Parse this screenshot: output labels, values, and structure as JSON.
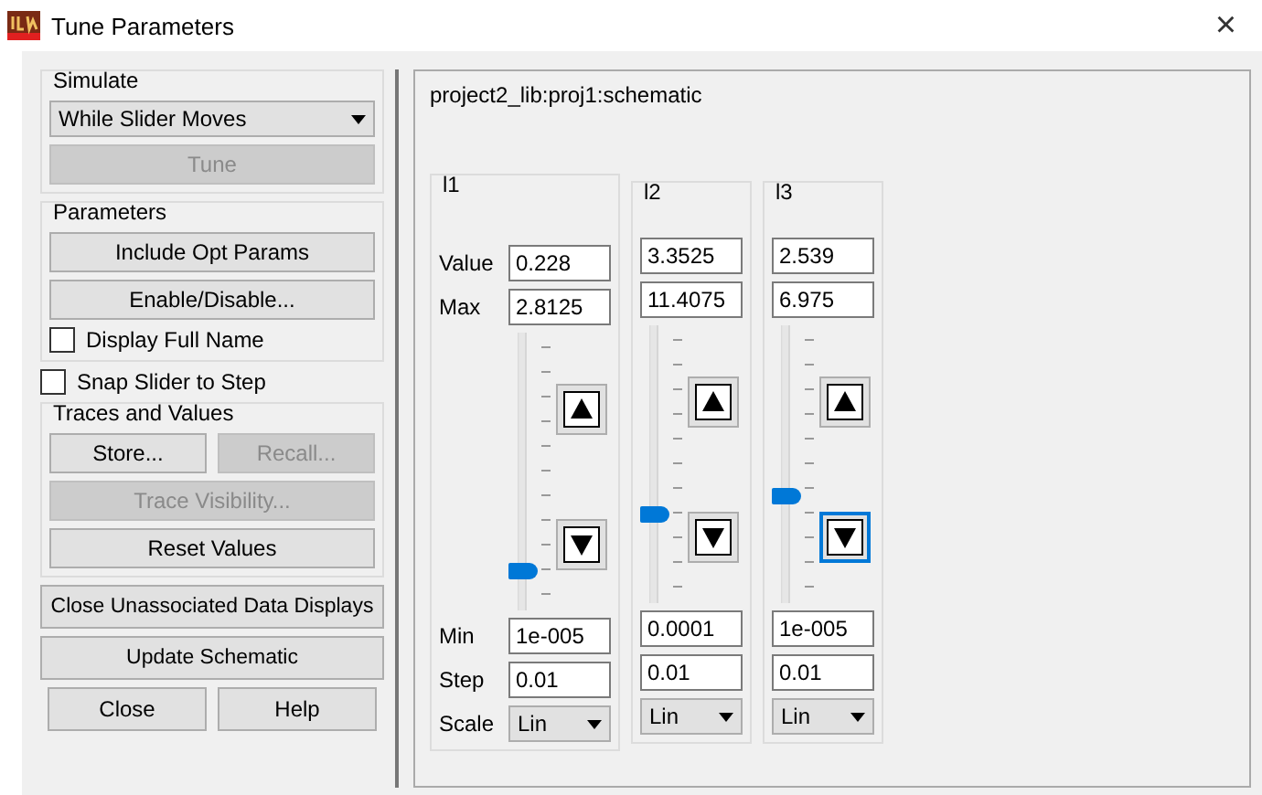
{
  "window": {
    "title": "Tune Parameters",
    "close": "×"
  },
  "simulate": {
    "legend": "Simulate",
    "mode": "While Slider Moves",
    "tune": {
      "label": "Tune",
      "disabled": true
    }
  },
  "parameters": {
    "legend": "Parameters",
    "buttons": [
      {
        "label": "Include Opt Params",
        "disabled": false
      },
      {
        "label": "Enable/Disable...",
        "disabled": false
      }
    ],
    "display_full_name": {
      "label": "Display Full Name",
      "checked": false
    }
  },
  "snap_slider": {
    "label": "Snap Slider to Step",
    "checked": false
  },
  "traces": {
    "legend": "Traces and Values",
    "store": {
      "label": "Store...",
      "disabled": false
    },
    "recall": {
      "label": "Recall...",
      "disabled": true
    },
    "trace_visibility": {
      "label": "Trace Visibility...",
      "disabled": true
    },
    "reset": {
      "label": "Reset Values",
      "disabled": false
    }
  },
  "bottom_buttons": [
    {
      "label": "Close Unassociated Data Displays"
    },
    {
      "label": "Update Schematic"
    }
  ],
  "dialog_buttons": [
    {
      "label": "Close"
    },
    {
      "label": "Help"
    }
  ],
  "design": "project2_lib:proj1:schematic",
  "row_labels": [
    "Value",
    "Max",
    "Min",
    "Step",
    "Scale"
  ],
  "params": [
    {
      "name": "l1",
      "value": "0.228",
      "max": "2.8125",
      "min": "1e-005",
      "step": "0.01",
      "scale": "Lin",
      "level": 0.12,
      "down_focused": false
    },
    {
      "name": "l2",
      "value": "3.3525",
      "max": "11.4075",
      "min": "0.0001",
      "step": "0.01",
      "scale": "Lin",
      "level": 0.31,
      "down_focused": false
    },
    {
      "name": "l3",
      "value": "2.539",
      "max": "6.975",
      "min": "1e-005",
      "step": "0.01",
      "scale": "Lin",
      "level": 0.38,
      "down_focused": true
    }
  ]
}
